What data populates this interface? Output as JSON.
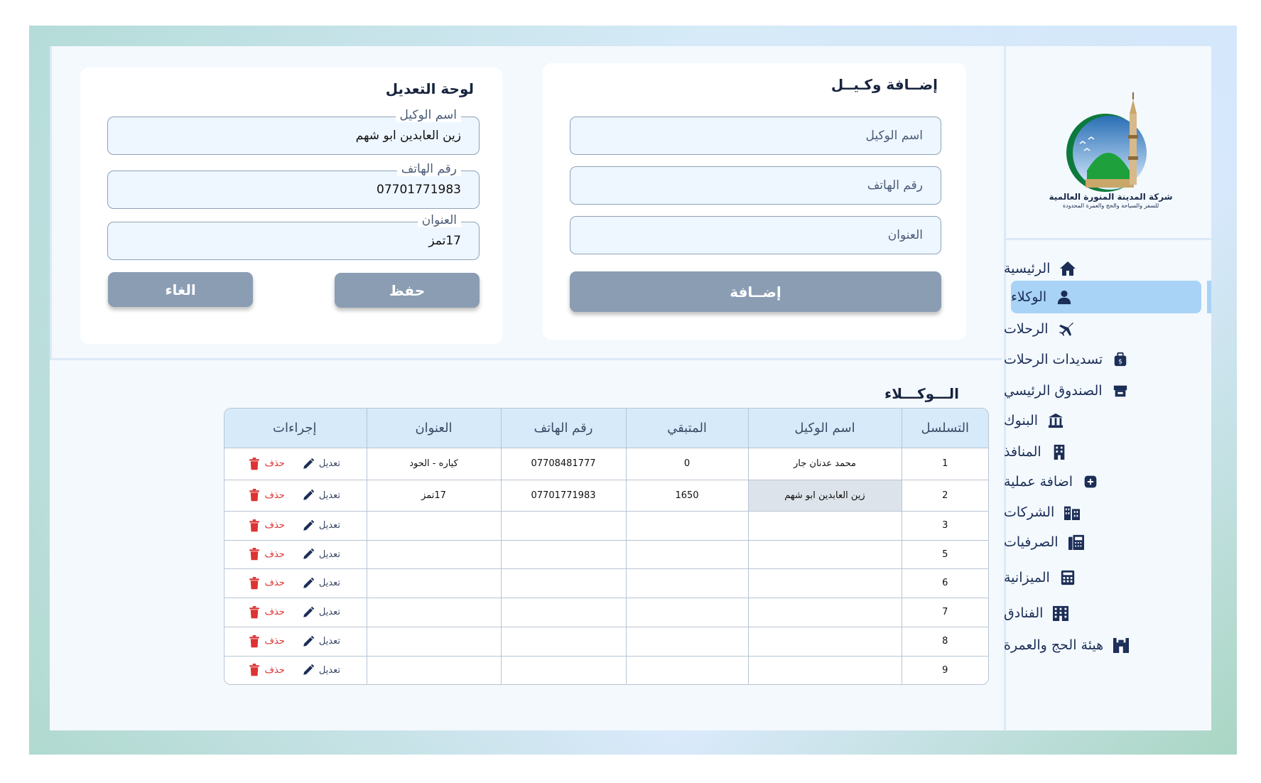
{
  "sidebar": {
    "logo": {
      "line1": "شركة المدينة المنورة العالمية",
      "line2": "للسفر والسياحة والحج والعمرة المحدودة"
    },
    "items": [
      {
        "label": "الرئيسية",
        "icon": "home-icon"
      },
      {
        "label": "الوكلاء",
        "icon": "user-icon",
        "active": true
      },
      {
        "label": "الرحلات",
        "icon": "airplane-icon"
      },
      {
        "label": "تسديدات الرحلات",
        "icon": "money-bag-icon"
      },
      {
        "label": "الصندوق الرئيسي",
        "icon": "cash-register-icon"
      },
      {
        "label": "البنوك",
        "icon": "bank-icon"
      },
      {
        "label": "المنافذ",
        "icon": "building-icon"
      },
      {
        "label": "اضافة عملية",
        "icon": "plus-square-icon"
      },
      {
        "label": "الشركات",
        "icon": "city-icon"
      },
      {
        "label": "الصرفيات",
        "icon": "fax-icon"
      },
      {
        "label": "الميزانية",
        "icon": "calculator-icon"
      },
      {
        "label": "الفنادق",
        "icon": "hotel-icon"
      },
      {
        "label": "هيئة الحج والعمرة",
        "icon": "kaaba-icon"
      }
    ]
  },
  "add_panel": {
    "title": "إضــافة وكـيــل",
    "name_placeholder": "اسم الوكيل",
    "phone_placeholder": "رقم الهاتف",
    "address_placeholder": "العنوان",
    "add_label": "إضــافة"
  },
  "edit_panel": {
    "title": "لوحة التعديل",
    "name_label": "اسم الوكيل",
    "name_value": "زين العابدين ابو شهم",
    "phone_label": "رقم الهاتف",
    "phone_value": "07701771983",
    "address_label": "العنوان",
    "address_value": "17تمز",
    "save_label": "حفظ",
    "cancel_label": "الغاء"
  },
  "agents_table": {
    "title": "الـــوكـــلاء",
    "headers": [
      "التسلسل",
      "اسم الوكيل",
      "المتبقي",
      "رقم الهاتف",
      "العنوان",
      "إجراءات"
    ],
    "edit_label": "تعديل",
    "delete_label": "حذف",
    "rows": [
      {
        "seq": "1",
        "name": "محمد عدنان جار",
        "remaining": "0",
        "phone": "07708481777",
        "address": "كياره - الحود"
      },
      {
        "seq": "2",
        "name": "زين العابدين ابو شهم",
        "remaining": "1650",
        "phone": "07701771983",
        "address": "17تمز"
      },
      {
        "seq": "3",
        "name": "",
        "remaining": "",
        "phone": "",
        "address": ""
      },
      {
        "seq": "5",
        "name": "",
        "remaining": "",
        "phone": "",
        "address": ""
      },
      {
        "seq": "6",
        "name": "",
        "remaining": "",
        "phone": "",
        "address": ""
      },
      {
        "seq": "7",
        "name": "",
        "remaining": "",
        "phone": "",
        "address": ""
      },
      {
        "seq": "8",
        "name": "",
        "remaining": "",
        "phone": "",
        "address": ""
      },
      {
        "seq": "9",
        "name": "",
        "remaining": "",
        "phone": "",
        "address": ""
      }
    ]
  },
  "colors": {
    "accent": "#a9d3f6",
    "button": "#8a9db3",
    "danger": "#dd3333",
    "navy": "#1b2e57"
  }
}
